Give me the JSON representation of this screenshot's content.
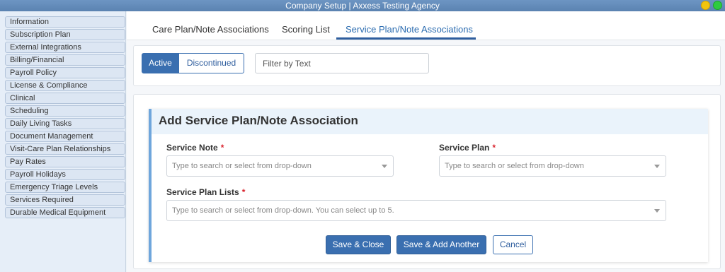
{
  "window": {
    "title": "Company Setup | Axxess Testing Agency"
  },
  "sidebar": {
    "items": [
      "Information",
      "Subscription Plan",
      "External Integrations",
      "Billing/Financial",
      "Payroll Policy",
      "License & Compliance",
      "Clinical",
      "Scheduling",
      "Daily Living Tasks",
      "Document Management",
      "Visit-Care Plan Relationships",
      "Pay Rates",
      "Payroll Holidays",
      "Emergency Triage Levels",
      "Services Required",
      "Durable Medical Equipment"
    ]
  },
  "tabs": {
    "care_plan": "Care Plan/Note Associations",
    "scoring": "Scoring List",
    "service_plan": "Service Plan/Note Associations",
    "active_tab": "Service Plan/Note Associations"
  },
  "filter": {
    "active_label": "Active",
    "discontinued_label": "Discontinued",
    "search_placeholder": "Filter by Text",
    "selected": "Active"
  },
  "form": {
    "title": "Add Service Plan/Note Association",
    "service_note_label": "Service Note",
    "service_note_placeholder": "Type to search or select from drop-down",
    "service_plan_label": "Service Plan",
    "service_plan_placeholder": "Type to search or select from drop-down",
    "service_plan_lists_label": "Service Plan Lists",
    "service_plan_lists_placeholder": "Type to search or select from drop-down. You can select up to 5.",
    "required_mark": "*",
    "save_close": "Save & Close",
    "save_add": "Save & Add Another",
    "cancel": "Cancel"
  },
  "colors": {
    "primary": "#3a6fb0",
    "title_bar": "#5b83b1",
    "required": "#d9232d",
    "card_accent": "#6fa6dc"
  }
}
